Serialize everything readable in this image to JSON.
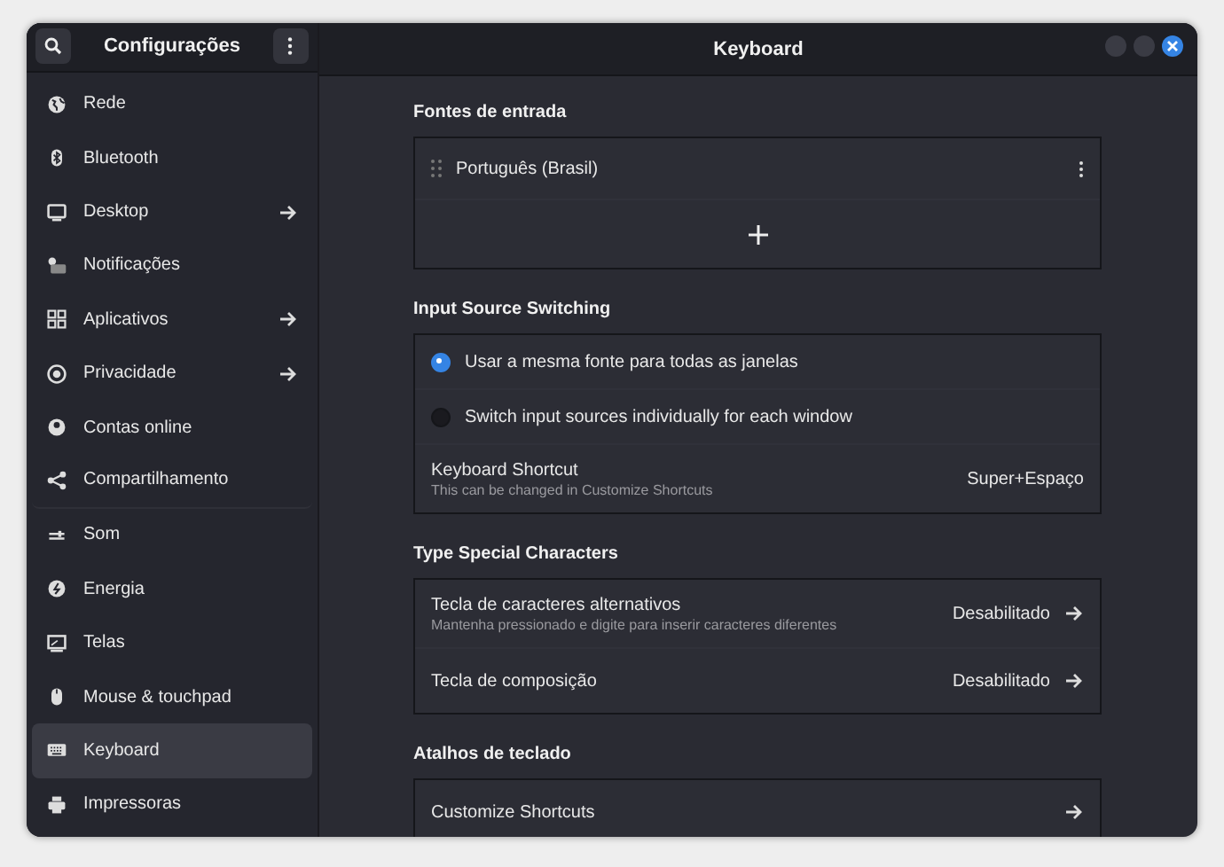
{
  "window": {
    "title": "Keyboard"
  },
  "sidebar": {
    "title": "Configurações",
    "items": [
      {
        "label": "Rede",
        "arrow": false,
        "selected": false
      },
      {
        "label": "Bluetooth",
        "arrow": false,
        "selected": false
      },
      {
        "label": "Desktop",
        "arrow": true,
        "selected": false
      },
      {
        "label": "Notificações",
        "arrow": false,
        "selected": false
      },
      {
        "label": "Aplicativos",
        "arrow": true,
        "selected": false
      },
      {
        "label": "Privacidade",
        "arrow": true,
        "selected": false
      },
      {
        "label": "Contas online",
        "arrow": false,
        "selected": false
      },
      {
        "label": "Compartilhamento",
        "arrow": false,
        "selected": false
      },
      {
        "label": "Som",
        "arrow": false,
        "selected": false
      },
      {
        "label": "Energia",
        "arrow": false,
        "selected": false
      },
      {
        "label": "Telas",
        "arrow": false,
        "selected": false
      },
      {
        "label": "Mouse & touchpad",
        "arrow": false,
        "selected": false
      },
      {
        "label": "Keyboard",
        "arrow": false,
        "selected": true
      },
      {
        "label": "Impressoras",
        "arrow": false,
        "selected": false
      }
    ]
  },
  "sections": [
    {
      "title": "Fontes de entrada",
      "rows": [
        {
          "kind": "source",
          "label": "Português (Brasil)"
        },
        {
          "kind": "add"
        }
      ]
    },
    {
      "title": "Input Source Switching",
      "rows": [
        {
          "kind": "radio",
          "label": "Usar a mesma fonte para todas as janelas",
          "selected": true
        },
        {
          "kind": "radio",
          "label": "Switch input sources individually for each window",
          "selected": false
        },
        {
          "kind": "value",
          "label": "Keyboard Shortcut",
          "subtitle": "This can be changed in Customize Shortcuts",
          "value": "Super+Espaço"
        }
      ]
    },
    {
      "title": "Type Special Characters",
      "rows": [
        {
          "kind": "link",
          "label": "Tecla de caracteres alternativos",
          "subtitle": "Mantenha pressionado e digite para inserir caracteres diferentes",
          "value": "Desabilitado"
        },
        {
          "kind": "link",
          "label": "Tecla de composição",
          "value": "Desabilitado"
        }
      ]
    },
    {
      "title": "Atalhos de teclado",
      "rows": [
        {
          "kind": "link",
          "label": "Customize Shortcuts"
        }
      ]
    }
  ]
}
